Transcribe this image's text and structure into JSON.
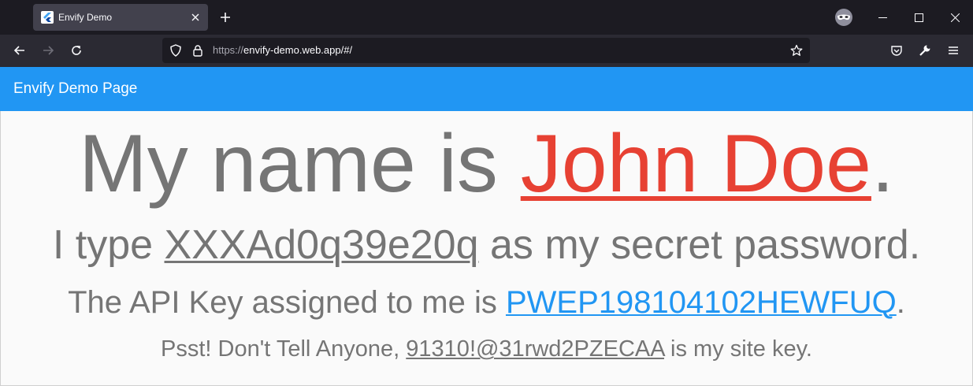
{
  "browser": {
    "tab": {
      "title": "Envify Demo"
    },
    "url": {
      "scheme": "https://",
      "host_path": "envify-demo.web.app/#/"
    }
  },
  "app": {
    "title": "Envify Demo Page"
  },
  "content": {
    "line1": {
      "prefix": "My name is ",
      "name": "John Doe",
      "suffix": "."
    },
    "line2": {
      "prefix": "I type ",
      "password": "XXXAd0q39e20q",
      "suffix": " as my secret password."
    },
    "line3": {
      "prefix": "The API Key assigned to me is ",
      "api_key": "PWEP198104102HEWFUQ",
      "suffix": "."
    },
    "line4": {
      "prefix": "Psst! Don't Tell Anyone, ",
      "site_key": "91310!@31rwd2PZECAA",
      "suffix": " is my site key."
    }
  },
  "colors": {
    "appbar": "#2196f3",
    "name_accent": "#e74133",
    "api_key_accent": "#2196f3",
    "text_grey": "#757575"
  },
  "icons": {
    "tab_favicon": "flutter-icon",
    "tab_close": "close-icon",
    "new_tab": "plus-icon",
    "private_mask": "mask-icon",
    "back": "arrow-left-icon",
    "forward": "arrow-right-icon",
    "reload": "reload-icon",
    "tracking": "shield-icon",
    "lock": "lock-icon",
    "bookmark": "star-icon",
    "pocket": "pocket-icon",
    "tools": "wrench-icon",
    "menu": "hamburger-icon"
  }
}
